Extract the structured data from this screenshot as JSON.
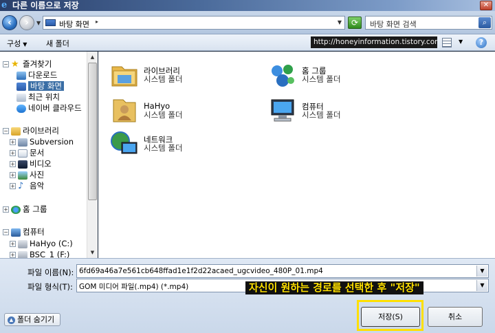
{
  "window": {
    "title": "다른 이름으로 저장",
    "close_label": "✕"
  },
  "address": {
    "location": "바탕 화면",
    "search_placeholder": "바탕 화면 검색"
  },
  "toolbar": {
    "organize": "구성",
    "new_folder": "새 폴더",
    "watermark_url": "http://honeyinformation.tistory.com"
  },
  "nav": {
    "favorites": "즐겨찾기",
    "downloads": "다운로드",
    "desktop": "바탕 화면",
    "recent": "최근 위치",
    "naver_cloud": "네이버 클라우드",
    "libraries": "라이브러리",
    "subversion": "Subversion",
    "documents": "문서",
    "videos": "비디오",
    "pictures": "사진",
    "music": "음악",
    "homegroup": "홈 그룹",
    "computer": "컴퓨터",
    "drive_c": "HaHyo (C:)",
    "drive_f": "BSC_1 (F:)"
  },
  "items": [
    {
      "name": "라이브러리",
      "type": "시스템 폴더"
    },
    {
      "name": "홈 그룹",
      "type": "시스템 폴더"
    },
    {
      "name": "HaHyo",
      "type": "시스템 폴더"
    },
    {
      "name": "컴퓨터",
      "type": "시스템 폴더"
    },
    {
      "name": "네트워크",
      "type": "시스템 폴더"
    }
  ],
  "form": {
    "filename_label": "파일 이름(N):",
    "filename_value": "6fd69a46a7e561cb648ffad1e1f2d22acaed_ugcvideo_480P_01.mp4",
    "filetype_label": "파일 형식(T):",
    "filetype_value": "GOM 미디어 파일(.mp4) (*.mp4)"
  },
  "annotation": "자신이 원하는 경로를 선택한 후 \"저장\"",
  "buttons": {
    "hide_folders": "폴더 숨기기",
    "save": "저장(S)",
    "cancel": "취소"
  },
  "colors": {
    "accent": "#3a6ea5",
    "highlight": "#ffe000"
  }
}
